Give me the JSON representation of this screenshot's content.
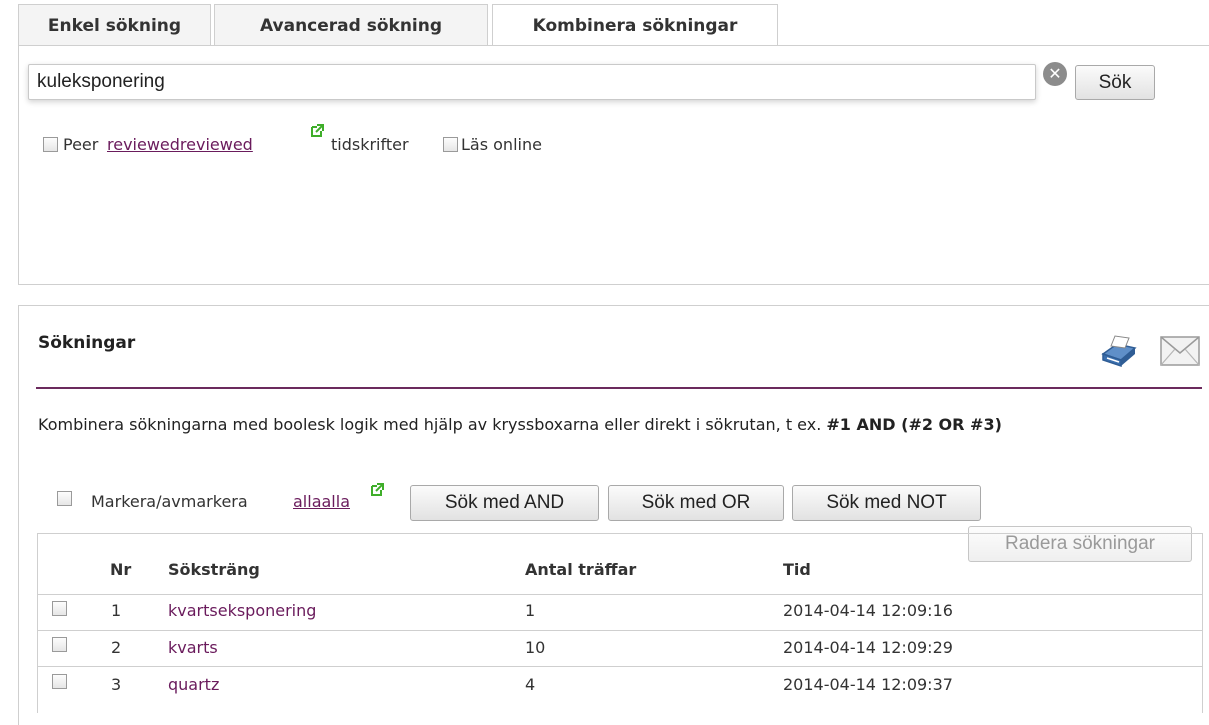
{
  "tabs": [
    {
      "label": "Enkel sökning"
    },
    {
      "label": "Avancerad sökning"
    },
    {
      "label": "Kombinera sökningar"
    }
  ],
  "search": {
    "value": "kuleksponering",
    "clear_glyph": "✕",
    "button_label": "Sök"
  },
  "filters": {
    "peer_prefix": "Peer",
    "peer_link": "reviewedreviewed",
    "peer_suffix": "tidskrifter",
    "online_label": "Läs online"
  },
  "searches": {
    "title": "Sökningar",
    "description_text": "Kombinera sökningarna med boolesk logik med hjälp av kryssboxarna eller direkt i sökrutan, t ex. ",
    "description_example": "#1 AND (#2 OR #3)",
    "select_all_prefix": "Markera/avmarkera",
    "select_all_link": "allaalla",
    "buttons": {
      "and": "Sök med AND",
      "or": "Sök med OR",
      "not": "Sök med NOT",
      "delete": "Radera sökningar"
    },
    "columns": {
      "nr": "Nr",
      "query": "Söksträng",
      "hits": "Antal träffar",
      "time": "Tid"
    },
    "rows": [
      {
        "nr": "1",
        "query": "kvartseksponering",
        "hits": "1",
        "time": "2014-04-14 12:09:16"
      },
      {
        "nr": "2",
        "query": "kvarts",
        "hits": "10",
        "time": "2014-04-14 12:09:29"
      },
      {
        "nr": "3",
        "query": "quartz",
        "hits": "4",
        "time": "2014-04-14 12:09:37"
      }
    ]
  },
  "colors": {
    "accent": "#6b2a5d",
    "link": "#6a1b5c",
    "external_icon": "#3fae2a"
  },
  "icons": {
    "print": "printer-icon",
    "email": "envelope-icon",
    "external": "external-link-icon",
    "clear": "clear-search-icon"
  }
}
